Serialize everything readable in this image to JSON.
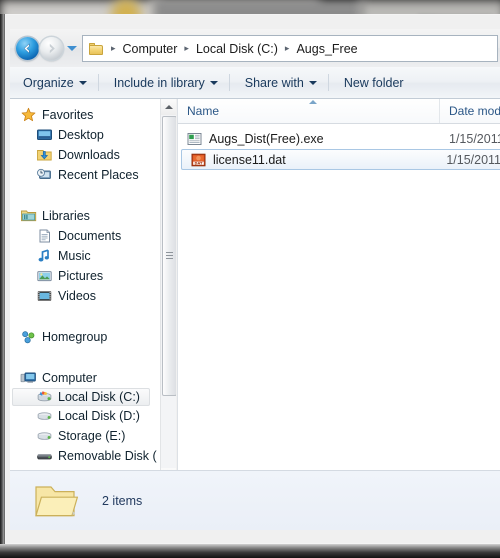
{
  "window": {
    "app": "Windows Explorer",
    "current_folder": "Augs_Free"
  },
  "nav": {
    "back_label": "Back",
    "forward_label": "Forward",
    "history_label": "Recent pages",
    "breadcrumb": [
      {
        "label": "Computer",
        "icon": "folder-icon"
      },
      {
        "label": "Local Disk (C:)",
        "icon": ""
      },
      {
        "label": "Augs_Free",
        "icon": ""
      }
    ],
    "separator": "▸"
  },
  "toolbar": {
    "items": [
      {
        "label": "Organize",
        "has_caret": true,
        "icon": ""
      },
      {
        "label": "Include in library",
        "has_caret": true,
        "icon": ""
      },
      {
        "label": "Share with",
        "has_caret": true,
        "icon": ""
      },
      {
        "label": "New folder",
        "has_caret": false,
        "icon": ""
      }
    ]
  },
  "sidebar": {
    "groups": [
      {
        "header": {
          "label": "Favorites",
          "icon": "star-icon"
        },
        "items": [
          {
            "label": "Desktop",
            "icon": "desktop-icon",
            "selected": false
          },
          {
            "label": "Downloads",
            "icon": "downloads-icon",
            "selected": false
          },
          {
            "label": "Recent Places",
            "icon": "recent-places-icon",
            "selected": false
          }
        ]
      },
      {
        "header": {
          "label": "Libraries",
          "icon": "libraries-icon"
        },
        "items": [
          {
            "label": "Documents",
            "icon": "documents-icon",
            "selected": false
          },
          {
            "label": "Music",
            "icon": "music-icon",
            "selected": false
          },
          {
            "label": "Pictures",
            "icon": "pictures-icon",
            "selected": false
          },
          {
            "label": "Videos",
            "icon": "videos-icon",
            "selected": false
          }
        ]
      },
      {
        "header": {
          "label": "Homegroup",
          "icon": "homegroup-icon"
        },
        "items": []
      },
      {
        "header": {
          "label": "Computer",
          "icon": "computer-icon"
        },
        "items": [
          {
            "label": "Local Disk (C:)",
            "icon": "system-drive-icon",
            "selected": true
          },
          {
            "label": "Local Disk (D:)",
            "icon": "drive-icon",
            "selected": false
          },
          {
            "label": "Storage (E:)",
            "icon": "drive-icon",
            "selected": false
          },
          {
            "label": "Removable Disk (",
            "icon": "removable-drive-icon",
            "selected": false
          }
        ]
      }
    ],
    "scrollbar": {
      "up_arrow": "▲",
      "down_arrow": "▼"
    }
  },
  "filelist": {
    "columns": [
      {
        "label": "Name",
        "sorted": true,
        "sort_direction": "asc"
      },
      {
        "label": "Date mod",
        "sorted": false,
        "sort_direction": ""
      }
    ],
    "rows": [
      {
        "name": "Augs_Dist(Free).exe",
        "date_modified": "1/15/2011",
        "icon": "application-icon",
        "selected": false
      },
      {
        "name": "license11.dat",
        "date_modified": "1/15/2011",
        "icon": "dat-file-icon",
        "selected": true
      }
    ]
  },
  "status": {
    "item_count_text": "2 items",
    "icon": "folder-icon"
  },
  "colors": {
    "accent_blue": "#2b5787",
    "selection_border": "#a9c7e4",
    "folder_yellow": "#f2d272",
    "dat_orange": "#d2491c"
  }
}
